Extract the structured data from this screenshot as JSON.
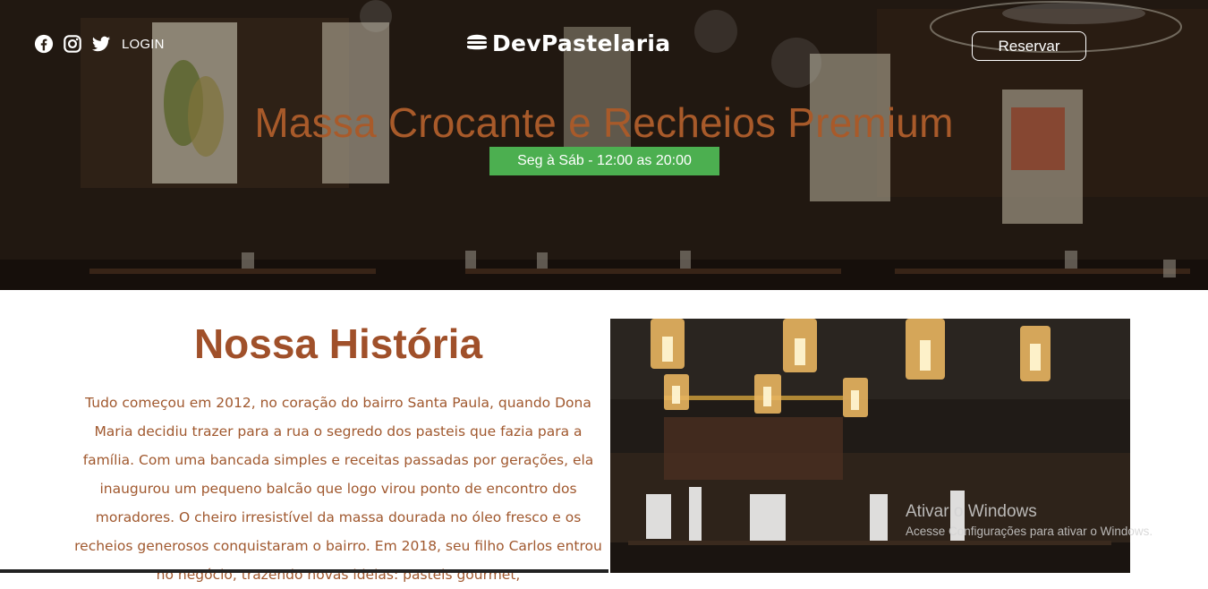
{
  "header": {
    "social": [
      {
        "icon": "facebook-icon"
      },
      {
        "icon": "instagram-icon"
      },
      {
        "icon": "twitter-icon"
      }
    ],
    "login_label": "LOGIN",
    "logo_icon": "burger-icon",
    "logo_text": "DevPastelaria",
    "reserve_label": "Reservar"
  },
  "hero": {
    "title": "Massa Crocante e Recheios Premium",
    "hours": "Seg à Sáb - 12:00 as 20:00"
  },
  "story": {
    "title": "Nossa História",
    "body": "Tudo começou em 2012, no coração do bairro Santa Paula, quando Dona Maria decidiu trazer para a rua o segredo dos pasteis que fazia para a família. Com uma bancada simples e receitas passadas por gerações, ela inaugurou um pequeno balcão que logo virou ponto de encontro dos moradores. O cheiro irresistível da massa dourada no óleo fresco e os recheios generosos conquistaram o bairro. Em 2018, seu filho Carlos entrou no negócio, trazendo novas ideias: pasteis gourmet,"
  },
  "watermark": {
    "title": "Ativar o Windows",
    "subtitle": "Acesse Configurações para ativar o Windows."
  },
  "colors": {
    "accent": "#a0502a",
    "badge": "#4caf50",
    "hero_title": "#a85a2a"
  }
}
